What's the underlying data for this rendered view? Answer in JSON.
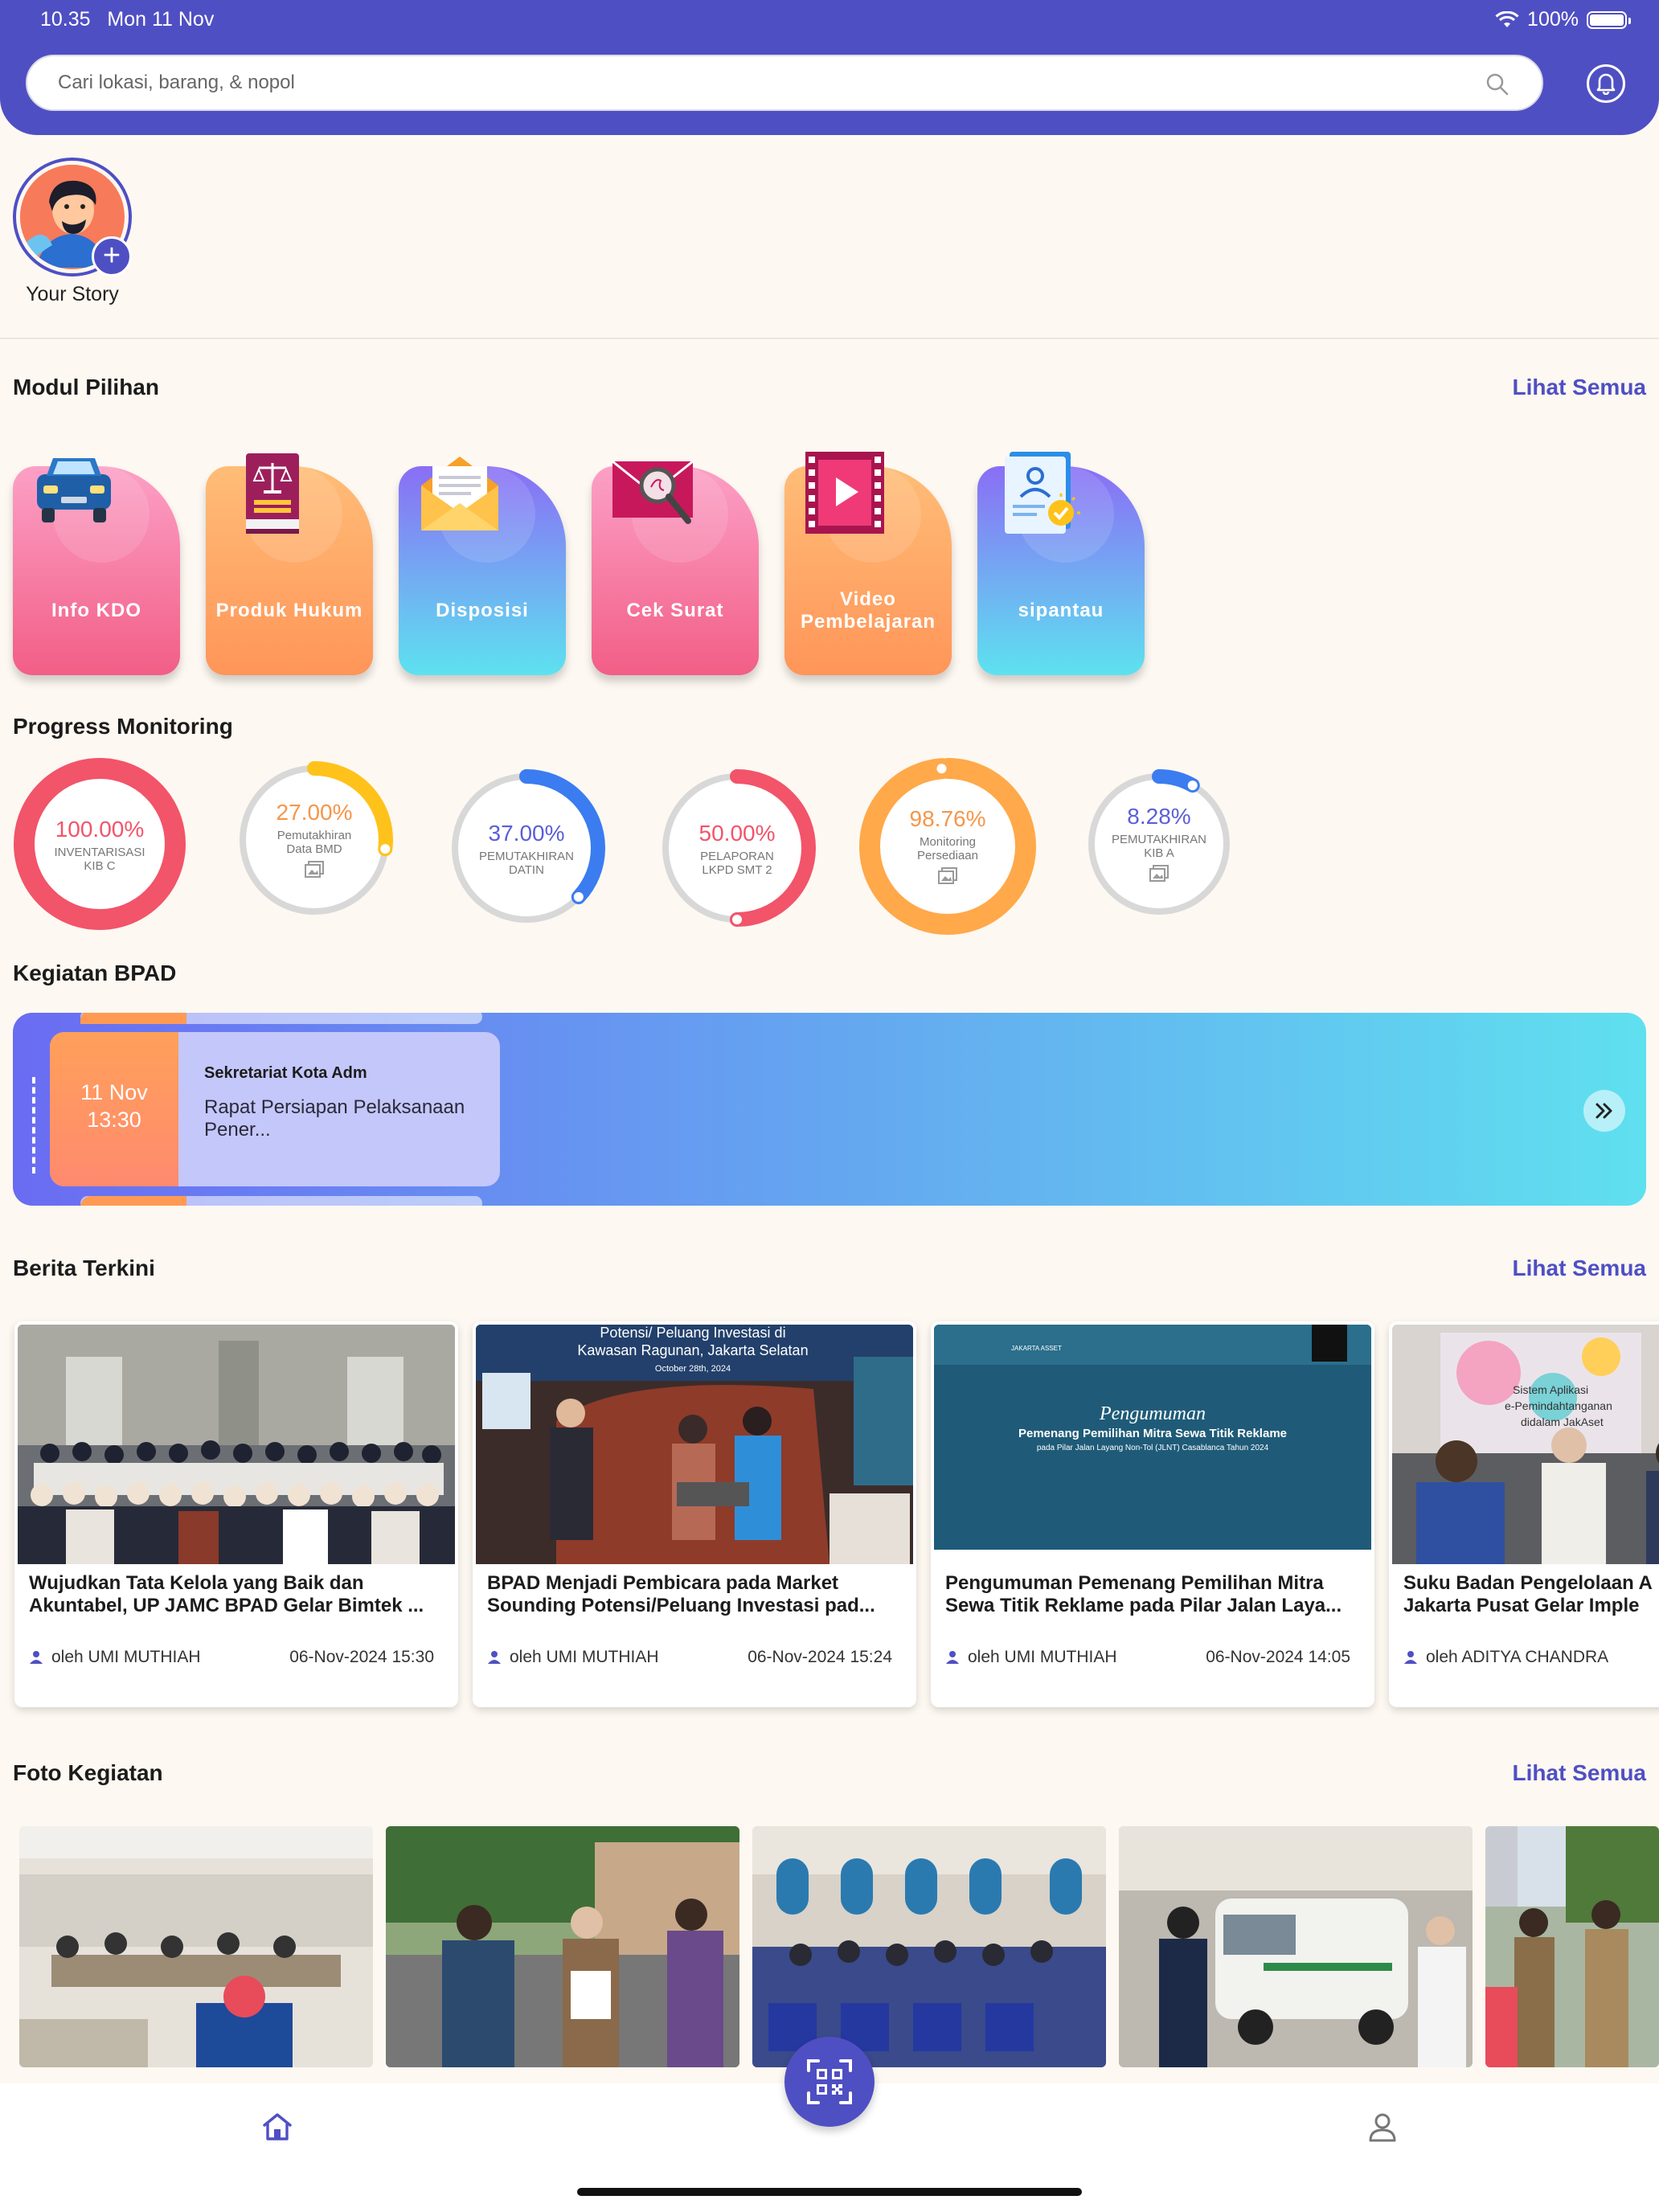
{
  "status_bar": {
    "time": "10.35",
    "date": "Mon 11 Nov",
    "battery": "100%"
  },
  "search": {
    "placeholder": "Cari lokasi, barang, & nopol"
  },
  "story": {
    "label": "Your Story"
  },
  "modules": {
    "title": "Modul Pilihan",
    "see_all": "Lihat Semua",
    "items": [
      {
        "label": "Info KDO",
        "icon": "car-icon"
      },
      {
        "label": "Produk Hukum",
        "icon": "law-book-icon"
      },
      {
        "label": "Disposisi",
        "icon": "envelope-icon"
      },
      {
        "label": "Cek Surat",
        "icon": "mail-search-icon"
      },
      {
        "label": "Video Pembelajaran",
        "icon": "video-icon"
      },
      {
        "label": "sipantau",
        "icon": "clipboard-user-icon"
      }
    ]
  },
  "progress": {
    "title": "Progress Monitoring",
    "items": [
      {
        "percent": "100.00%",
        "value": 100.0,
        "caption1": "INVENTARISASI",
        "caption2": "KIB C",
        "color": "#f2546a",
        "pct_color": "#f2546a"
      },
      {
        "percent": "27.00%",
        "value": 27.0,
        "caption1": "Pemutakhiran",
        "caption2": "Data BMD",
        "color": "#ffc21a",
        "pct_color": "#f5964a"
      },
      {
        "percent": "37.00%",
        "value": 37.0,
        "caption1": "PEMUTAKHIRAN",
        "caption2": "DATIN",
        "color": "#3b7cf0",
        "pct_color": "#5b5fd6"
      },
      {
        "percent": "50.00%",
        "value": 50.0,
        "caption1": "PELAPORAN",
        "caption2": "LKPD SMT 2",
        "color": "#f2546a",
        "pct_color": "#f2546a"
      },
      {
        "percent": "98.76%",
        "value": 98.76,
        "caption1": "Monitoring",
        "caption2": "Persediaan",
        "color": "#ffa94a",
        "pct_color": "#f5964a"
      },
      {
        "percent": "8.28%",
        "value": 8.28,
        "caption1": "PEMUTAKHIRAN",
        "caption2": "KIB A",
        "color": "#3b7cf0",
        "pct_color": "#5b5fd6"
      }
    ]
  },
  "kegiatan": {
    "title": "Kegiatan BPAD",
    "event": {
      "day": "11 Nov",
      "time": "13:30",
      "organizer": "Sekretariat Kota Adm",
      "title": "Rapat Persiapan Pelaksanaan Pener..."
    }
  },
  "news": {
    "title": "Berita Terkini",
    "see_all": "Lihat Semua",
    "items": [
      {
        "line1": "Wujudkan Tata Kelola yang Baik dan",
        "line2": "Akuntabel, UP JAMC BPAD Gelar Bimtek ...",
        "author": "oleh UMI MUTHIAH",
        "date": "06-Nov-2024 15:30"
      },
      {
        "line1": "BPAD Menjadi Pembicara pada Market",
        "line2": "Sounding Potensi/Peluang Investasi pad...",
        "author": "oleh UMI MUTHIAH",
        "date": "06-Nov-2024 15:24",
        "img_heading": "Potensi/ Peluang Investasi di",
        "img_heading2": "Kawasan Ragunan, Jakarta Selatan",
        "img_date": "October 28th, 2024"
      },
      {
        "line1": "Pengumuman Pemenang Pemilihan Mitra",
        "line2": "Sewa Titik Reklame pada Pilar Jalan Laya...",
        "author": "oleh UMI MUTHIAH",
        "date": "06-Nov-2024 14:05",
        "img_script": "Pengumuman",
        "img_heading": "Pemenang Pemilihan Mitra Sewa Titik Reklame",
        "img_sub": "pada Pilar Jalan Layang Non-Tol (JLNT) Casablanca Tahun 2024",
        "img_brand": "JAKARTA ASSET"
      },
      {
        "line1": "Suku Badan Pengelolaan A",
        "line2": "Jakarta Pusat Gelar Imple",
        "author": "oleh ADITYA CHANDRA",
        "date": "",
        "img_banner1": "Sistem Aplikasi",
        "img_banner2": "e-Pemindahtanganan",
        "img_banner3": "didalam JakAset"
      }
    ]
  },
  "photos": {
    "title": "Foto Kegiatan",
    "see_all": "Lihat Semua",
    "count": 5
  },
  "nav": {
    "home": "home-icon",
    "scan": "qr-scan-icon",
    "profile": "user-icon"
  },
  "colors": {
    "primary": "#4f4fc4",
    "background": "#fdf8f1"
  }
}
